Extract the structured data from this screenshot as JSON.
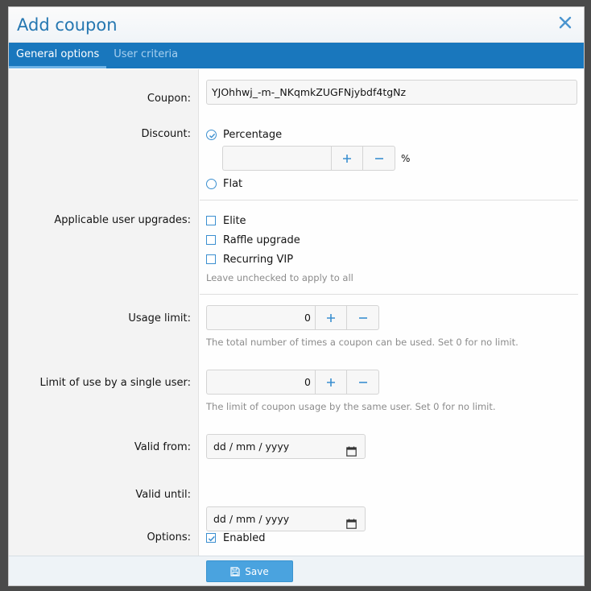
{
  "dialog": {
    "title": "Add coupon",
    "tabs": [
      {
        "label": "General options",
        "active": true
      },
      {
        "label": "User criteria",
        "active": false
      }
    ]
  },
  "form": {
    "coupon": {
      "label": "Coupon:",
      "value": "YJOhhwj_-m-_NKqmkZUGFNjybdf4tgNz"
    },
    "discount": {
      "label": "Discount:",
      "options": [
        {
          "label": "Percentage",
          "selected": true
        },
        {
          "label": "Flat",
          "selected": false
        }
      ],
      "value": "",
      "suffix": "%"
    },
    "upgrades": {
      "label": "Applicable user upgrades:",
      "options": [
        {
          "label": "Elite",
          "checked": false
        },
        {
          "label": "Raffle upgrade",
          "checked": false
        },
        {
          "label": "Recurring VIP",
          "checked": false
        }
      ],
      "hint": "Leave unchecked to apply to all"
    },
    "usage_limit": {
      "label": "Usage limit:",
      "value": "0",
      "hint": "The total number of times a coupon can be used. Set 0 for no limit."
    },
    "user_limit": {
      "label": "Limit of use by a single user:",
      "value": "0",
      "hint": "The limit of coupon usage by the same user. Set 0 for no limit."
    },
    "valid_from": {
      "label": "Valid from:",
      "placeholder": "dd / mm / yyyy"
    },
    "valid_until": {
      "label": "Valid until:",
      "placeholder": "dd / mm / yyyy"
    },
    "options": {
      "label": "Options:",
      "enabled_label": "Enabled",
      "enabled": true
    }
  },
  "footer": {
    "save_label": "Save"
  },
  "colors": {
    "accent": "#1977bd",
    "title": "#2577b1",
    "save": "#4aa3df"
  }
}
